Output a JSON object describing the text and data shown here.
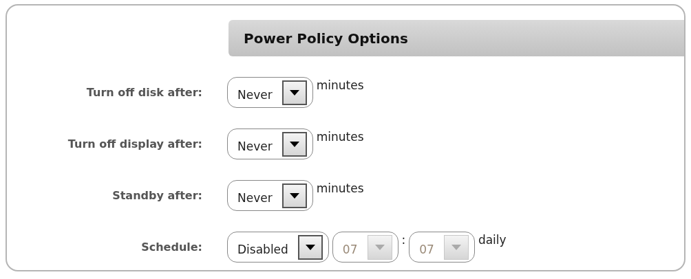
{
  "section": {
    "title": "Power Policy Options"
  },
  "rows": [
    {
      "label": "Turn off disk after:",
      "items": [
        {
          "kind": "select",
          "value": "Never",
          "disabled": false
        },
        {
          "kind": "text",
          "text": "minutes"
        }
      ]
    },
    {
      "label": "Turn off display after:",
      "items": [
        {
          "kind": "select",
          "value": "Never",
          "disabled": false
        },
        {
          "kind": "text",
          "text": "minutes"
        }
      ]
    },
    {
      "label": "Standby after:",
      "items": [
        {
          "kind": "select",
          "value": "Never",
          "disabled": false
        },
        {
          "kind": "text",
          "text": "minutes"
        }
      ]
    },
    {
      "label": "Schedule:",
      "items": [
        {
          "kind": "select",
          "value": "Disabled",
          "disabled": false
        },
        {
          "kind": "select",
          "value": "07",
          "disabled": true
        },
        {
          "kind": "text",
          "text": ":"
        },
        {
          "kind": "select",
          "value": "07",
          "disabled": true
        },
        {
          "kind": "text",
          "text": "daily"
        }
      ]
    }
  ]
}
